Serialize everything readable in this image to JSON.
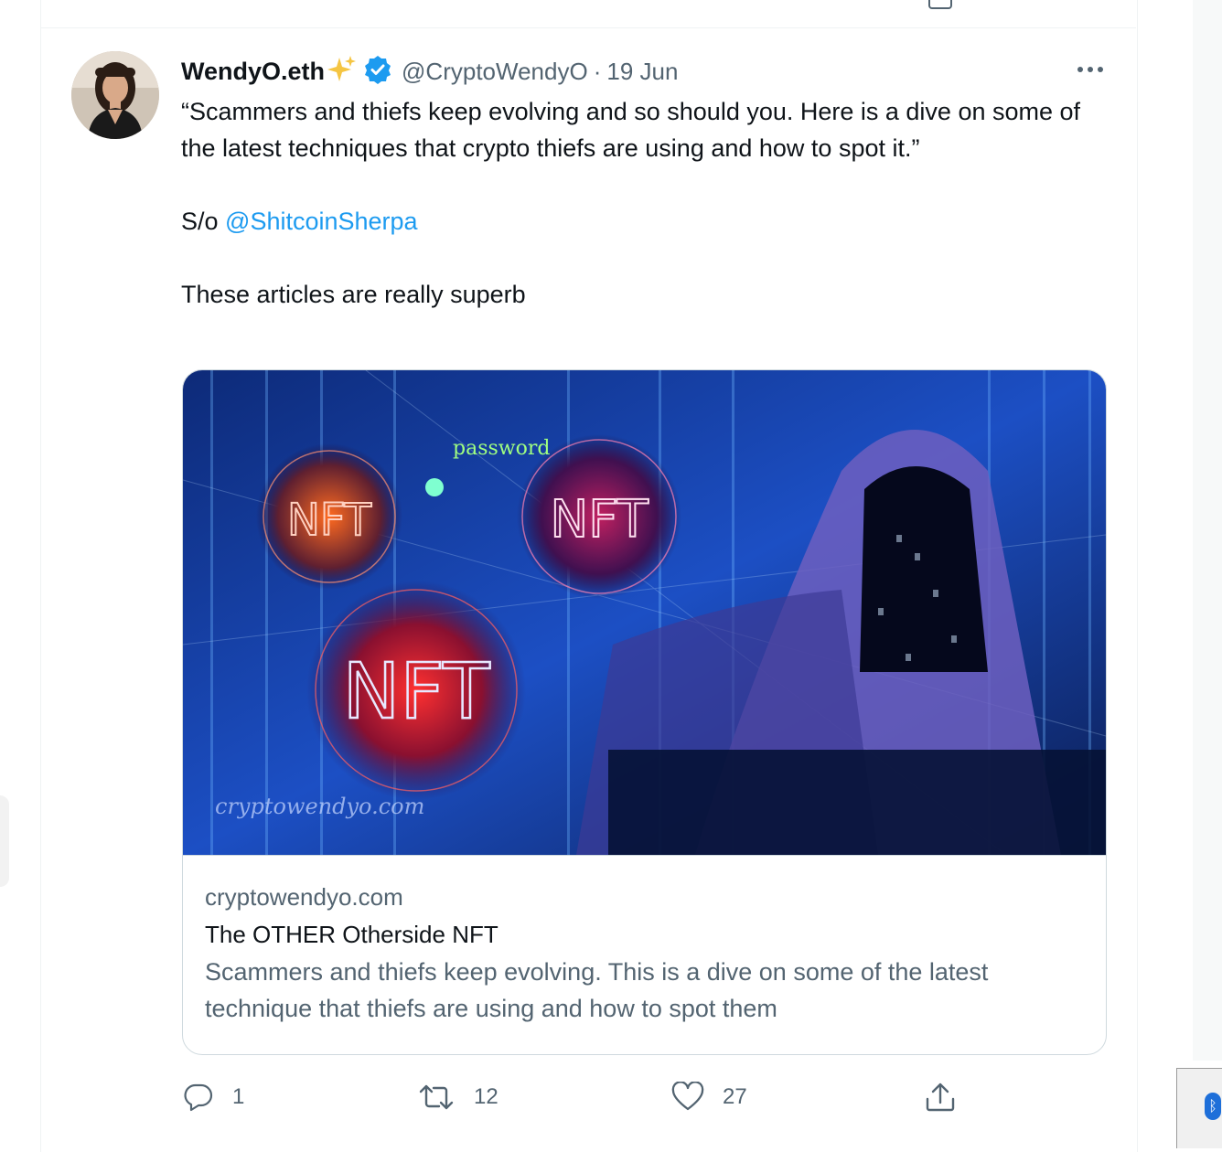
{
  "tweet": {
    "author_name": "WendyO.eth",
    "handle": "@CryptoWendyO",
    "separator": "·",
    "date": "19 Jun",
    "text_lines": [
      "“Scammers and thiefs keep evolving and so should you. Here is a dive on some of the latest techniques that crypto thiefs are using and how to spot it.”"
    ],
    "shoutout_prefix": "S/o ",
    "mention": "@ShitcoinSherpa",
    "closing": "These articles are really superb"
  },
  "card": {
    "image_labels": {
      "nft_1": "NFT",
      "nft_2": "NFT",
      "nft_3": "NFT",
      "password": "password",
      "watermark": "cryptowendyo.com"
    },
    "domain": "cryptowendyo.com",
    "title": "The OTHER Otherside NFT",
    "description": "Scammers and thiefs keep evolving. This is a dive on some of the latest technique that thiefs are using and how to spot them"
  },
  "actions": {
    "reply_count": "1",
    "retweet_count": "12",
    "like_count": "27"
  },
  "colors": {
    "accent": "#1d9bf0",
    "secondary_text": "#536471",
    "border": "#cfd9de"
  },
  "icons": [
    "more-icon",
    "verified-icon",
    "sparkles-icon",
    "reply-icon",
    "retweet-icon",
    "like-icon",
    "share-icon",
    "bluetooth-icon"
  ]
}
